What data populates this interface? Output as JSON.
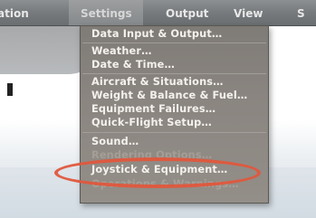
{
  "menubar": {
    "titles": {
      "simulation": "ation",
      "settings": "Settings",
      "output": "Output",
      "view": "View",
      "rest": "S"
    }
  },
  "settings_menu": {
    "items": {
      "data_input_output": "Data Input & Output…",
      "weather": "Weather…",
      "date_time": "Date & Time…",
      "aircraft_situations": "Aircraft & Situations…",
      "weight_balance_fuel": "Weight & Balance & Fuel…",
      "equipment_failures": "Equipment Failures…",
      "quick_flight_setup": "Quick-Flight Setup…",
      "sound": "Sound…",
      "rendering_options": "Rendering Options…",
      "joystick_equipment": "Joystick & Equipment…",
      "operations_warnings": "Operations & Warnings…"
    }
  },
  "colors": {
    "menu_background": "#8a8580",
    "menu_text": "#f4f1ec",
    "highlight_ring": "#e0573c",
    "menubar_background": "#767a7d"
  }
}
